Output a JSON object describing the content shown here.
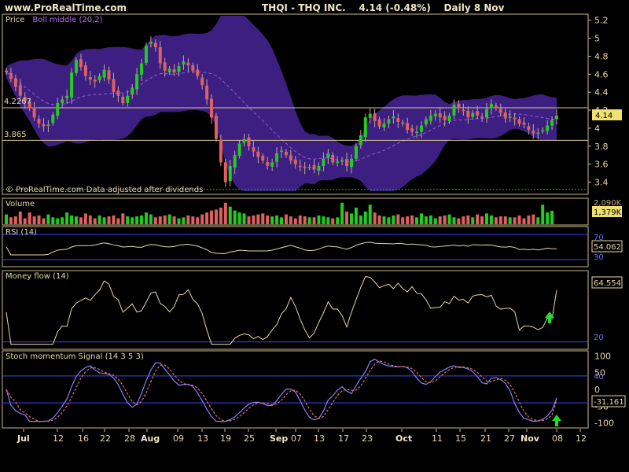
{
  "header": {
    "site": "www.ProRealTime.com",
    "symbol": "THQI - THQ INC.",
    "price": "4.14",
    "change": "(-0.48%)",
    "period": "Daily",
    "date": "8 Nov"
  },
  "panels": {
    "price": {
      "title": "Price",
      "indicator": "Boll middle (20,2)",
      "watermark": "© ProRealTime.com  Data adjusted after dividends",
      "line_labels": [
        "4.2267",
        "3.865"
      ],
      "last": "4.14"
    },
    "volume": {
      "title": "Volume",
      "last": "1,379K",
      "prev": "2,090K"
    },
    "rsi": {
      "title": "RSI (14)",
      "last": "54.062",
      "levels": [
        "70",
        "30"
      ]
    },
    "mflow": {
      "title": "Money flow (14)",
      "last": "64.554",
      "level": "20"
    },
    "stoch": {
      "title": "Stoch momentum Signal (14 3 5 3)",
      "last": "-31.161",
      "level": "40"
    }
  },
  "colors": {
    "up": "#22cc22",
    "down": "#e06060",
    "band": "#3c1f80",
    "accent": "#f0e6c8"
  },
  "chart_data": {
    "type": "candlestick",
    "x_tick_labels": [
      "Jul",
      "12",
      "16",
      "22",
      "28",
      "Aug",
      "09",
      "13",
      "19",
      "25",
      "Sep",
      "07",
      "13",
      "17",
      "23",
      "Oct",
      "11",
      "15",
      "21",
      "27",
      "Nov",
      "08",
      "12"
    ],
    "price_ticks": [
      "5.2",
      "5",
      "4.8",
      "4.6",
      "4.4",
      "4.2",
      "4",
      "3.8",
      "3.6",
      "3.4"
    ],
    "price_ylim": [
      3.3,
      5.25
    ],
    "horizontal_lines": [
      4.2267,
      3.865
    ],
    "closes": [
      4.62,
      4.55,
      4.46,
      4.36,
      4.3,
      4.22,
      4.12,
      4.05,
      4.02,
      4.04,
      4.15,
      4.28,
      4.32,
      4.36,
      4.62,
      4.76,
      4.68,
      4.58,
      4.54,
      4.52,
      4.58,
      4.65,
      4.54,
      4.4,
      4.36,
      4.28,
      4.36,
      4.45,
      4.6,
      4.72,
      4.92,
      4.96,
      4.9,
      4.72,
      4.64,
      4.66,
      4.62,
      4.69,
      4.74,
      4.7,
      4.64,
      4.58,
      4.48,
      4.32,
      4.12,
      3.88,
      3.62,
      3.4,
      3.58,
      3.7,
      3.83,
      3.88,
      3.8,
      3.74,
      3.68,
      3.64,
      3.58,
      3.62,
      3.72,
      3.75,
      3.7,
      3.64,
      3.6,
      3.58,
      3.56,
      3.57,
      3.54,
      3.58,
      3.66,
      3.72,
      3.62,
      3.63,
      3.64,
      3.58,
      3.66,
      3.8,
      3.92,
      4.12,
      4.16,
      4.08,
      4.02,
      4.05,
      4.1,
      4.13,
      4.07,
      4.05,
      3.98,
      3.96,
      3.96,
      4.03,
      4.1,
      4.14,
      4.16,
      4.12,
      4.09,
      4.14,
      4.26,
      4.22,
      4.2,
      4.12,
      4.17,
      4.14,
      4.12,
      4.21,
      4.27,
      4.22,
      4.17,
      4.11,
      4.13,
      4.1,
      4.05,
      4.04,
      3.98,
      3.94,
      3.95,
      3.98,
      4.03,
      4.09,
      4.14
    ],
    "volume_ylim": [
      0,
      2500
    ],
    "volumes": [
      1000,
      700,
      800,
      1300,
      600,
      1200,
      800,
      900,
      600,
      1000,
      700,
      600,
      700,
      1200,
      900,
      800,
      700,
      1100,
      900,
      600,
      900,
      700,
      800,
      900,
      600,
      1100,
      800,
      700,
      800,
      900,
      1200,
      1000,
      700,
      800,
      900,
      1000,
      800,
      600,
      700,
      900,
      800,
      700,
      1000,
      1200,
      1400,
      1500,
      1700,
      2200,
      1800,
      1400,
      1200,
      1100,
      800,
      900,
      1000,
      1100,
      900,
      800,
      900,
      700,
      1000,
      800,
      600,
      900,
      800,
      700,
      700,
      900,
      800,
      700,
      600,
      700,
      2200,
      1300,
      1100,
      1700,
      900,
      1300,
      2000,
      1200,
      900,
      800,
      700,
      900,
      1000,
      700,
      800,
      900,
      700,
      1100,
      800,
      900,
      600,
      800,
      900,
      1000,
      700,
      600,
      800,
      900,
      700,
      1000,
      800,
      1100,
      900,
      700,
      800,
      800,
      700,
      700,
      900,
      600,
      900,
      1000,
      700,
      2000,
      1200,
      1379
    ],
    "rsi_ylim": [
      20,
      80
    ],
    "rsi_levels": [
      70,
      30
    ],
    "rsi_last": 54.062,
    "mflow_ylim": [
      15,
      80
    ],
    "mflow_level": 20,
    "mflow_last": 64.554,
    "stoch_ylim": [
      -110,
      110
    ],
    "stoch_ticks": [
      "100",
      "50",
      "0",
      "-50",
      "-100"
    ],
    "stoch_level": 40,
    "stoch_last": -31.161
  }
}
